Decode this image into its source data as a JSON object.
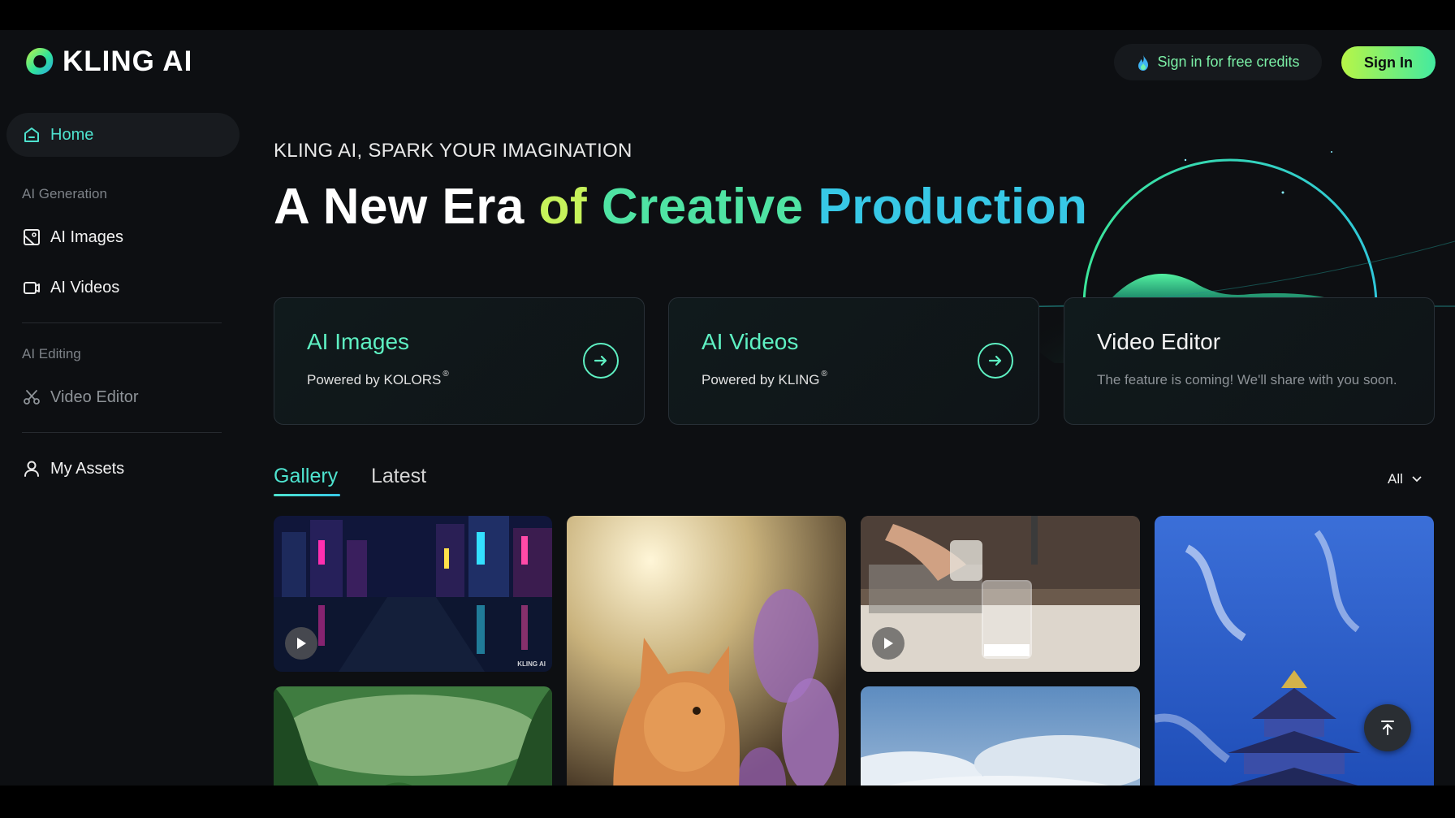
{
  "app": {
    "logo_text": "KLING AI"
  },
  "header": {
    "credits_label": "Sign in for free credits",
    "signin_label": "Sign In"
  },
  "sidebar": {
    "home": "Home",
    "section_generation": "AI Generation",
    "ai_images": "AI Images",
    "ai_videos": "AI Videos",
    "section_editing": "AI Editing",
    "video_editor": "Video Editor",
    "my_assets": "My Assets"
  },
  "hero": {
    "kicker": "KLING AI, SPARK YOUR IMAGINATION",
    "title_words": [
      "A New Era",
      "of",
      "Creative",
      "Production"
    ]
  },
  "cards": [
    {
      "title": "AI Images",
      "subtitle": "Powered by KOLORS",
      "reg": "®",
      "arrow": true
    },
    {
      "title": "AI Videos",
      "subtitle": "Powered by KLING",
      "reg": "®",
      "arrow": true
    },
    {
      "title": "Video Editor",
      "subtitle": "The feature is coming! We'll share with you soon.",
      "reg": "",
      "arrow": false
    }
  ],
  "gallery": {
    "tabs": [
      "Gallery",
      "Latest"
    ],
    "active_tab": "Gallery",
    "filter_label": "All",
    "watermark": "KLING AI",
    "tiles": [
      {
        "subject": "neon city street at night",
        "has_play": true
      },
      {
        "subject": "orange kitten among purple flowers",
        "has_play": false
      },
      {
        "subject": "pouring milk into glass",
        "has_play": true
      },
      {
        "subject": "temple of heaven under blue sky",
        "has_play": false
      },
      {
        "subject": "green jungle foliage",
        "has_play": false
      },
      {
        "subject": "sky with clouds",
        "has_play": false
      }
    ]
  },
  "colors": {
    "accent_teal": "#4ee3cf",
    "accent_green": "#5ef0c2",
    "signin_gradient_start": "#b7f547",
    "signin_gradient_end": "#43eaa0",
    "background": "#0d0f12"
  },
  "icons": {
    "logo": "kling-logo-icon",
    "credits": "flame-icon",
    "home": "home-icon",
    "images": "image-icon",
    "videos": "video-camera-icon",
    "editor": "scissors-icon",
    "assets": "user-icon",
    "card_arrow": "arrow-right-circle-icon",
    "filter": "chevron-down-icon",
    "scroll_top": "arrow-up-icon",
    "play": "play-icon"
  }
}
